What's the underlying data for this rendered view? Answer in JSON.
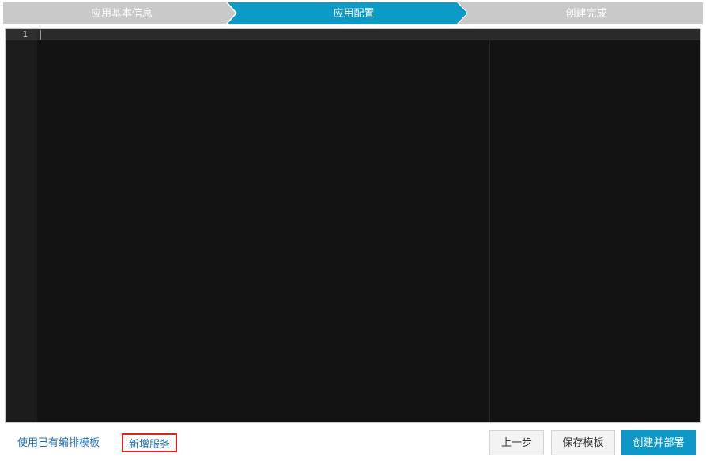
{
  "wizard": {
    "steps": [
      {
        "label": "应用基本信息",
        "state": "done"
      },
      {
        "label": "应用配置",
        "state": "active"
      },
      {
        "label": "创建完成",
        "state": "pending"
      }
    ],
    "colors": {
      "active": "#0c9ac6",
      "inactive": "#c9c9c9"
    }
  },
  "editor": {
    "line_numbers": [
      "1"
    ],
    "content": ""
  },
  "footer": {
    "use_template_link": "使用已有编排模板",
    "add_service_link": "新增服务",
    "prev_button": "上一步",
    "save_template_button": "保存模板",
    "create_deploy_button": "创建并部署"
  },
  "colors": {
    "primary_button": "#0e98c7",
    "link": "#1f6fb2",
    "highlight_border": "#e02020"
  }
}
